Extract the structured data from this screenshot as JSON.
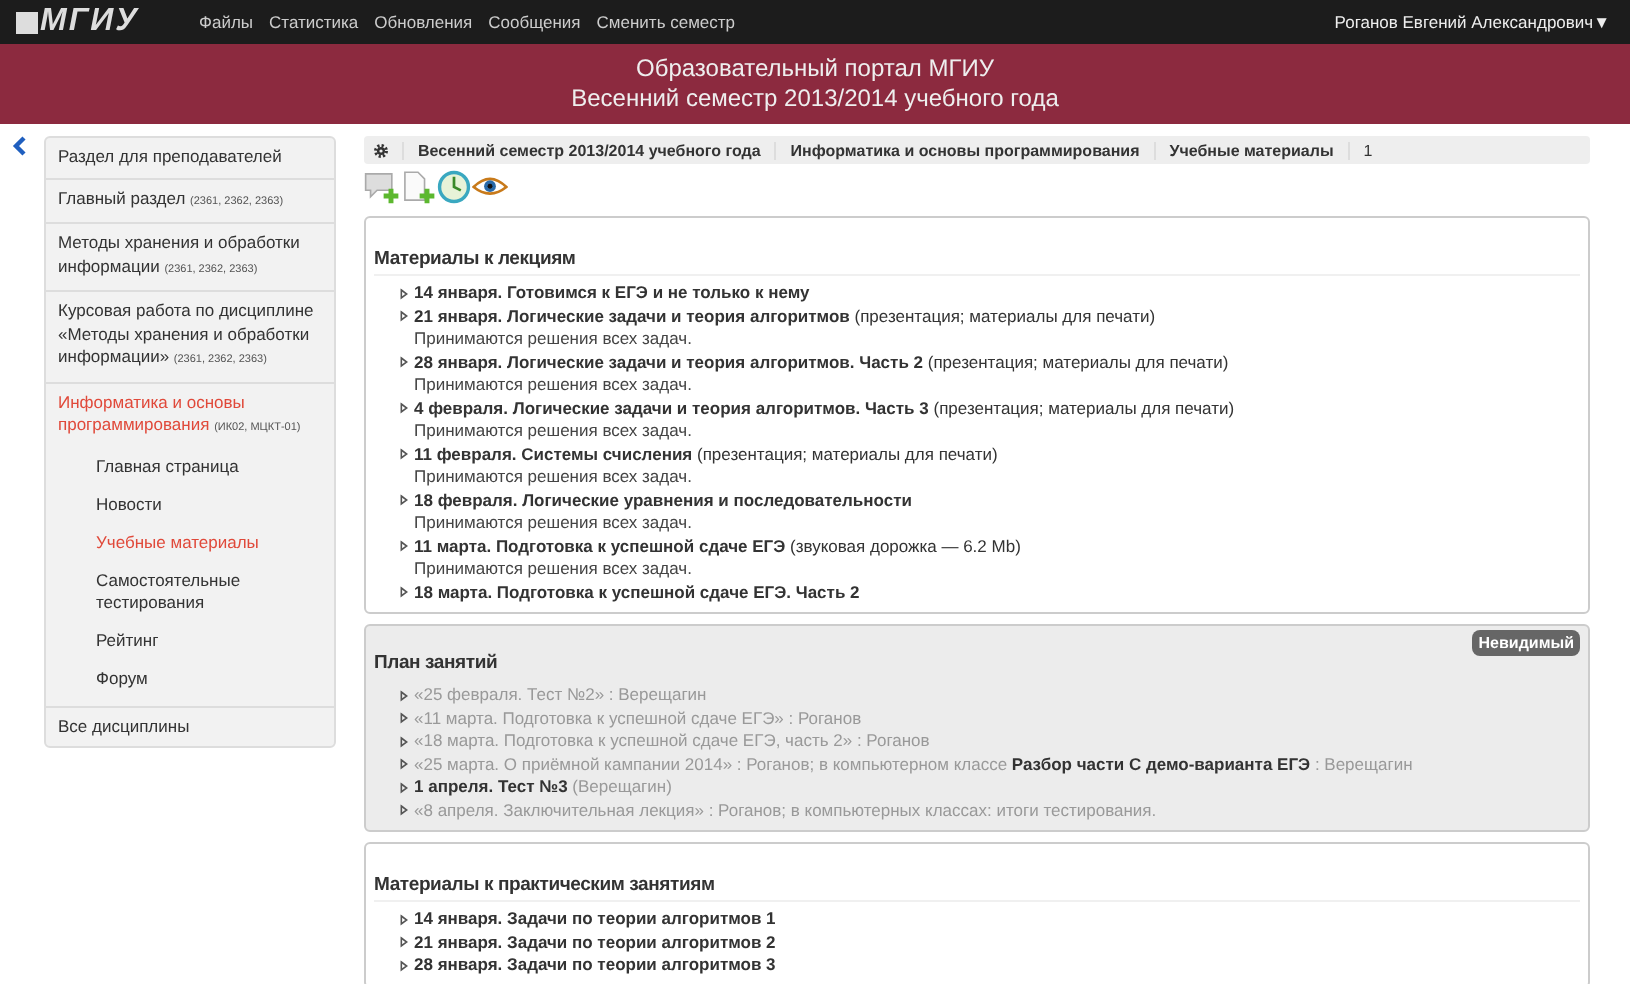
{
  "topbar": {
    "logo": "МГИУ",
    "menu": [
      "Файлы",
      "Статистика",
      "Обновления",
      "Сообщения",
      "Сменить семестр"
    ],
    "user": "Роганов Евгений Александрович▼"
  },
  "header": {
    "title": "Образовательный портал МГИУ",
    "subtitle": "Весенний семестр 2013/2014 учебного года"
  },
  "sidebar": {
    "items": [
      {
        "label": "Раздел для преподавателей",
        "selected": false
      },
      {
        "label": "Главный раздел",
        "note": "(2361, 2362, 2363)",
        "selected": false
      },
      {
        "label": "Методы хранения и обработки информации",
        "note": "(2361, 2362, 2363)",
        "selected": false
      },
      {
        "label": "Курсовая работа по дисциплине «Методы хранения и обработки информации»",
        "note": "(2361, 2362, 2363)",
        "selected": false
      },
      {
        "label": "Информатика и основы программирования",
        "note": "(ИК02, МЦКТ-01)",
        "selected": true,
        "children": [
          {
            "label": "Главная страница",
            "selected": false
          },
          {
            "label": "Новости",
            "selected": false
          },
          {
            "label": "Учебные материалы",
            "selected": true
          },
          {
            "label": "Самостоятельные тестирования",
            "selected": false
          },
          {
            "label": "Рейтинг",
            "selected": false
          },
          {
            "label": "Форум",
            "selected": false
          }
        ]
      },
      {
        "label": "Все дисциплины",
        "selected": false
      }
    ]
  },
  "breadcrumbs": [
    "Весенний семестр 2013/2014 учебного года",
    "Информатика и основы программирования",
    "Учебные материалы",
    "1"
  ],
  "sections": [
    {
      "title": "Материалы к лекциям",
      "hidden": false,
      "items": [
        {
          "text": "**14 января. Готовимся к ЕГЭ и не только к нему**"
        },
        {
          "text": "**21 января. Логические задачи и теория алгоритмов** (презентация; материалы для печати)",
          "note": "Принимаются решения всех задач."
        },
        {
          "text": "**28 января. Логические задачи и теория алгоритмов. Часть 2** (презентация; материалы для печати)",
          "note": "Принимаются решения всех задач."
        },
        {
          "text": "**4 февраля. Логические задачи и теория алгоритмов. Часть 3** (презентация; материалы для печати)",
          "note": "Принимаются решения всех задач."
        },
        {
          "text": "**11 февраля. Системы счисления** (презентация; материалы для печати)",
          "note": "Принимаются решения всех задач."
        },
        {
          "text": "**18 февраля. Логические уравнения и последовательности**",
          "note": "Принимаются решения всех задач."
        },
        {
          "text": "**11 марта. Подготовка к успешной сдаче ЕГЭ** (звуковая дорожка — 6.2 Mb)",
          "note": "Принимаются решения всех задач."
        },
        {
          "text": "**18 марта. Подготовка к успешной сдаче ЕГЭ. Часть 2**"
        }
      ]
    },
    {
      "title": "План занятий",
      "hidden": true,
      "badge": "Невидимый",
      "items": [
        {
          "text": "«25 февраля. Тест №2» : Верещагин"
        },
        {
          "text": "«11 марта. Подготовка к успешной сдаче ЕГЭ» : Роганов"
        },
        {
          "text": "«18 марта. Подготовка к успешной сдаче ЕГЭ, часть 2» : Роганов"
        },
        {
          "text": "«25 марта. О приёмной кампании 2014» : Роганов; в компьютерном классе **Разбор части С демо-варианта ЕГЭ** : Верещагин"
        },
        {
          "text": "**1 апреля. Тест №3** (Верещагин)"
        },
        {
          "text": "«8 апреля. Заключительная лекция» : Роганов; в компьютерных классах: итоги тестирования."
        }
      ]
    },
    {
      "title": "Материалы к практическим занятиям",
      "hidden": false,
      "items": [
        {
          "text": "**14 января. Задачи по теории алгоритмов 1**"
        },
        {
          "text": "**21 января. Задачи по теории алгоритмов 2**"
        },
        {
          "text": "**28 января. Задачи по теории алгоритмов 3**"
        }
      ]
    }
  ]
}
